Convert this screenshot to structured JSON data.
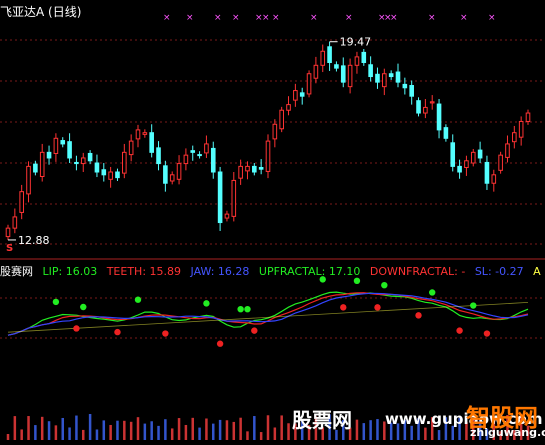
{
  "chart_data": {
    "type": "candlestick",
    "title": "飞亚达A",
    "period": "(日线)",
    "price_labels": {
      "high": "19.47",
      "low": "12.88"
    },
    "high_value": 19.47,
    "low_value": 12.88,
    "marker_s": "S",
    "price_range": [
      12.5,
      20.3
    ],
    "closes": [
      13.1,
      13.5,
      14.4,
      15.3,
      15.1,
      15.8,
      15.6,
      16.3,
      16.1,
      15.6,
      15.4,
      15.6,
      15.5,
      15.1,
      15.0,
      15.1,
      14.9,
      15.8,
      16.2,
      16.6,
      16.5,
      15.8,
      15.4,
      14.7,
      15.0,
      15.4,
      15.7,
      15.8,
      15.7,
      16.1,
      15.1,
      13.3,
      13.6,
      14.8,
      15.3,
      15.3,
      15.1,
      15.2,
      16.2,
      16.8,
      17.3,
      17.5,
      18.0,
      17.8,
      18.6,
      18.9,
      19.4,
      19.0,
      18.8,
      18.3,
      18.9,
      19.2,
      19.0,
      18.5,
      18.3,
      18.6,
      18.5,
      18.3,
      18.1,
      17.8,
      17.2,
      17.4,
      17.6,
      16.6,
      16.3,
      15.3,
      15.1,
      15.5,
      15.8,
      15.6,
      14.7,
      15.0,
      15.7,
      16.1,
      16.5,
      16.9,
      17.2
    ]
  },
  "indicator": {
    "brand": "股赛网",
    "lip": "LIP: 16.03",
    "teeth": "TEETH: 15.89",
    "jaw": "JAW: 16.28",
    "upfractal": "UPFRACTAL: 17.10",
    "downfractal": "DOWNFRACTAL: -",
    "sl": "SL: -0.27",
    "flag": "A"
  },
  "watermarks": {
    "site_cn": "股票网",
    "site_url": "www.gupiaow.com",
    "logo_cn": "智股网",
    "logo_url": "zhiguwang.com"
  },
  "colors": {
    "up": "#ff3333",
    "down": "#54ffff",
    "green_dot": "#22ee22",
    "red_dot": "#ee2222",
    "lip": "#22ee22",
    "teeth": "#ee2222",
    "jaw": "#3344ff",
    "magenta": "#ff55ff",
    "yellow": "#ffff44"
  }
}
